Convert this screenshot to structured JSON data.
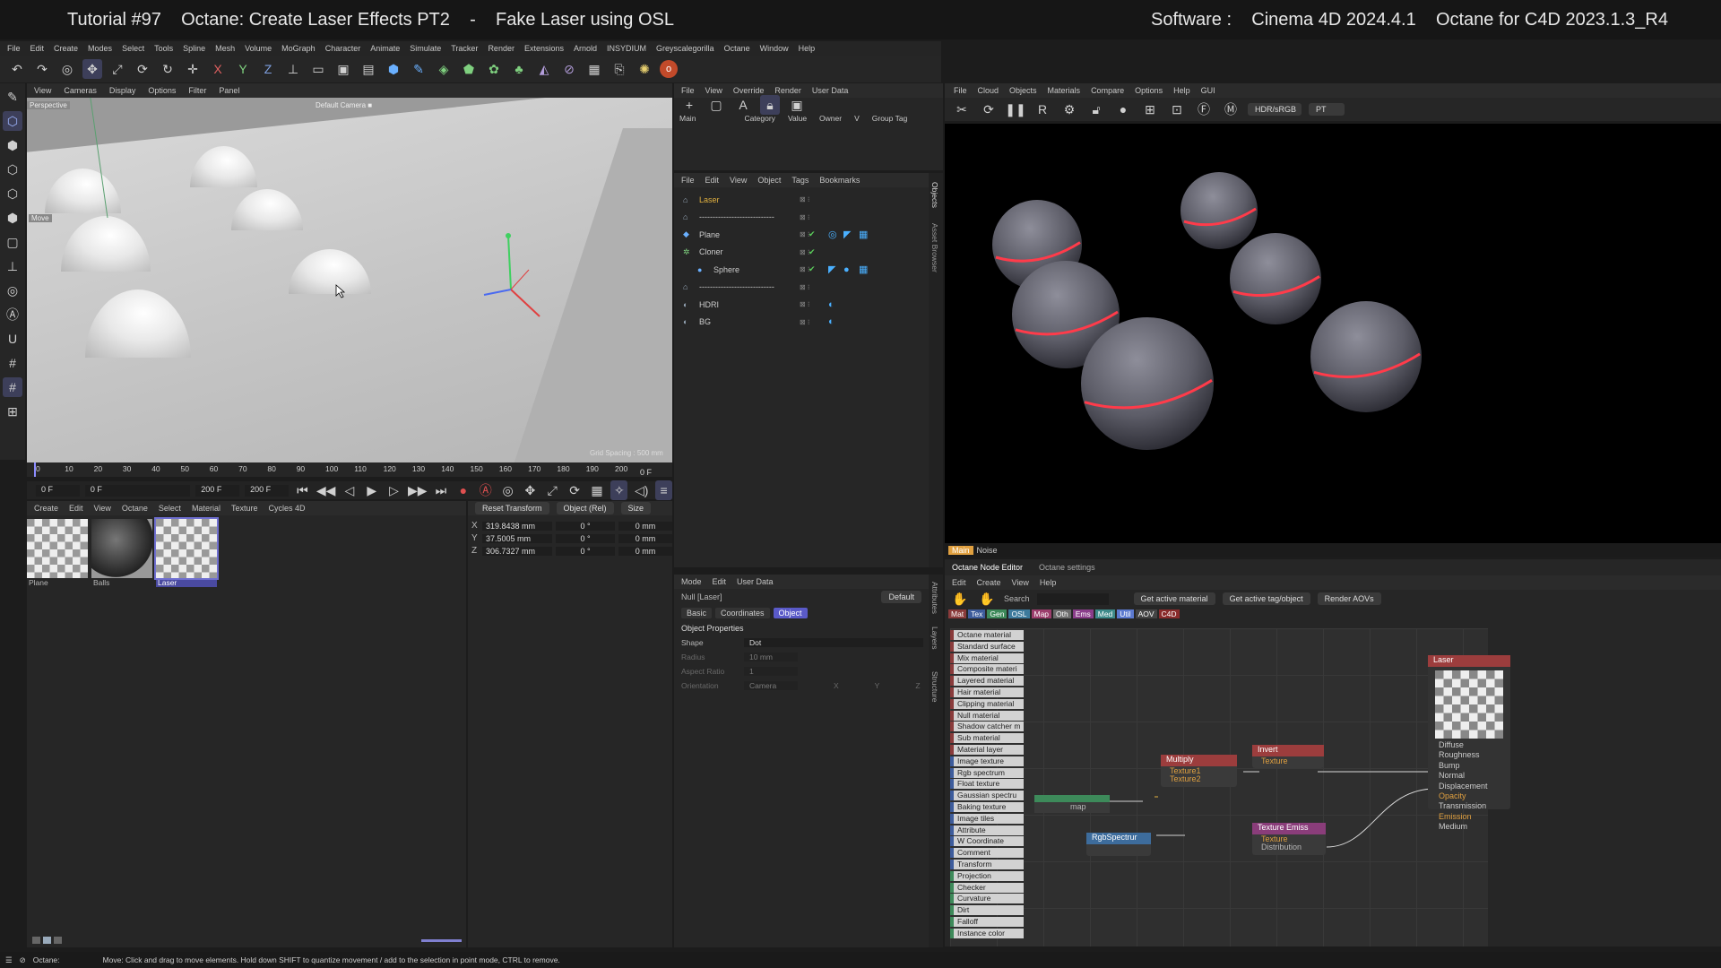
{
  "title_bar": {
    "left": "Tutorial #97    Octane: Create Laser Effects PT2    -    Fake Laser using OSL",
    "right": "Software :    Cinema 4D 2024.4.1    Octane for C4D 2023.1.3_R4"
  },
  "main_menu": [
    "File",
    "Edit",
    "Create",
    "Modes",
    "Select",
    "Tools",
    "Spline",
    "Mesh",
    "Volume",
    "MoGraph",
    "Character",
    "Animate",
    "Simulate",
    "Tracker",
    "Render",
    "Extensions",
    "Arnold",
    "INSYDIUM",
    "Greyscalegorilla",
    "Octane",
    "Window",
    "Help"
  ],
  "viewport": {
    "menu": [
      "View",
      "Cameras",
      "Display",
      "Options",
      "Filter",
      "Panel"
    ],
    "camera_label": "Perspective",
    "cam_tag": "Default Camera ■",
    "move_label": "Move",
    "grid_label": "Grid Spacing : 500 mm"
  },
  "timeline": {
    "ticks": [
      "0",
      "10",
      "20",
      "30",
      "40",
      "50",
      "60",
      "70",
      "80",
      "90",
      "100",
      "110",
      "120",
      "130",
      "140",
      "150",
      "160",
      "170",
      "180",
      "190",
      "200"
    ],
    "frame_current": "0 F",
    "field_start": "0 F",
    "field_start2": "0 F",
    "field_end": "200 F",
    "field_end2": "200 F"
  },
  "material_manager": {
    "menu": [
      "Create",
      "Edit",
      "View",
      "Octane",
      "Select",
      "Material",
      "Texture",
      "Cycles 4D"
    ],
    "materials": [
      "Plane",
      "Balls",
      "Laser"
    ]
  },
  "coordinates": {
    "reset": "Reset Transform",
    "mode": "Object (Rel)",
    "size": "Size",
    "rows": [
      {
        "axis": "X",
        "pos": "319.8438 mm",
        "rot": "0 °",
        "size": "0 mm"
      },
      {
        "axis": "Y",
        "pos": "37.5005 mm",
        "rot": "0 °",
        "size": "0 mm"
      },
      {
        "axis": "Z",
        "pos": "306.7327 mm",
        "rot": "0 °",
        "size": "0 mm"
      }
    ]
  },
  "takes": {
    "menu": [
      "File",
      "View",
      "Override",
      "Render",
      "User Data"
    ],
    "cols": [
      "Main",
      "Category",
      "Value",
      "Owner",
      "V",
      "Group Tag"
    ]
  },
  "objects": {
    "menu": [
      "File",
      "Edit",
      "View",
      "Object",
      "Tags",
      "Bookmarks"
    ],
    "tab": "Objects",
    "side_tab2": "Asset Browser",
    "items": [
      {
        "name": "Laser"
      },
      {
        "name": "----------------------------"
      },
      {
        "name": "Plane"
      },
      {
        "name": "Cloner"
      },
      {
        "name": "Sphere"
      },
      {
        "name": "----------------------------"
      },
      {
        "name": "HDRI"
      },
      {
        "name": "BG"
      }
    ]
  },
  "attributes": {
    "menu": [
      "Mode",
      "Edit",
      "User Data"
    ],
    "object": "Null [Laser]",
    "preset": "Default",
    "tabs": [
      "Basic",
      "Coordinates",
      "Object"
    ],
    "section": "Object Properties",
    "side_tabs": [
      "Attributes",
      "Layers",
      "Structure"
    ],
    "props": [
      {
        "label": "Shape",
        "value": "Dot"
      },
      {
        "label": "Radius",
        "value": "10 mm"
      },
      {
        "label": "Aspect Ratio",
        "value": "1"
      },
      {
        "label": "Orientation",
        "value": "Camera"
      }
    ],
    "axis_labels": [
      "X",
      "Y",
      "Z"
    ]
  },
  "live_viewer": {
    "menu": [
      "File",
      "Cloud",
      "Objects",
      "Materials",
      "Compare",
      "Options",
      "Help",
      "GUI"
    ],
    "color_space": "HDR/sRGB",
    "kernel": "PT",
    "bottom_tabs": [
      "Main",
      "Noise"
    ]
  },
  "node_editor": {
    "tabs": [
      "Octane Node Editor",
      "Octane settings"
    ],
    "menu": [
      "Edit",
      "Create",
      "View",
      "Help"
    ],
    "search": "Search",
    "buttons": [
      "Get active material",
      "Get active tag/object",
      "Render AOVs"
    ],
    "cats": [
      "Mat",
      "Tex",
      "Gen",
      "OSL",
      "Map",
      "Oth",
      "Ems",
      "Med",
      "Util",
      "AOV",
      "C4D"
    ],
    "list": [
      "Octane material",
      "Standard surface",
      "Mix material",
      "Composite materi",
      "Layered material",
      "Hair material",
      "Clipping material",
      "Null material",
      "Shadow catcher m",
      "Sub material",
      "Material layer",
      "Image texture",
      "Rgb spectrum",
      "Float texture",
      "Gaussian spectru",
      "Baking texture",
      "Image tiles",
      "Attribute",
      "W Coordinate",
      "Comment",
      "Transform",
      "Projection",
      "Checker",
      "Curvature",
      "Dirt",
      "Falloff",
      "Instance color"
    ],
    "laser_node": {
      "title": "Laser",
      "ports": [
        "Diffuse",
        "Roughness",
        "Bump",
        "Normal",
        "Displacement",
        "Opacity",
        "Transmission",
        "Emission",
        "Medium"
      ]
    },
    "multiply": {
      "title": "Multiply",
      "ports": [
        "Texture1",
        "Texture2"
      ]
    },
    "invert": {
      "title": "Invert",
      "ports": [
        "Texture"
      ]
    },
    "tex_emission": {
      "title": "Texture Emiss",
      "ports": [
        "Texture",
        "Distribution"
      ]
    },
    "rgb": {
      "title": "RgbSpectrur"
    },
    "partial": "map"
  },
  "status": {
    "app": "Octane:",
    "text": "Move: Click and drag to move elements. Hold down SHIFT to quantize movement / add to the selection in point mode, CTRL to remove."
  }
}
